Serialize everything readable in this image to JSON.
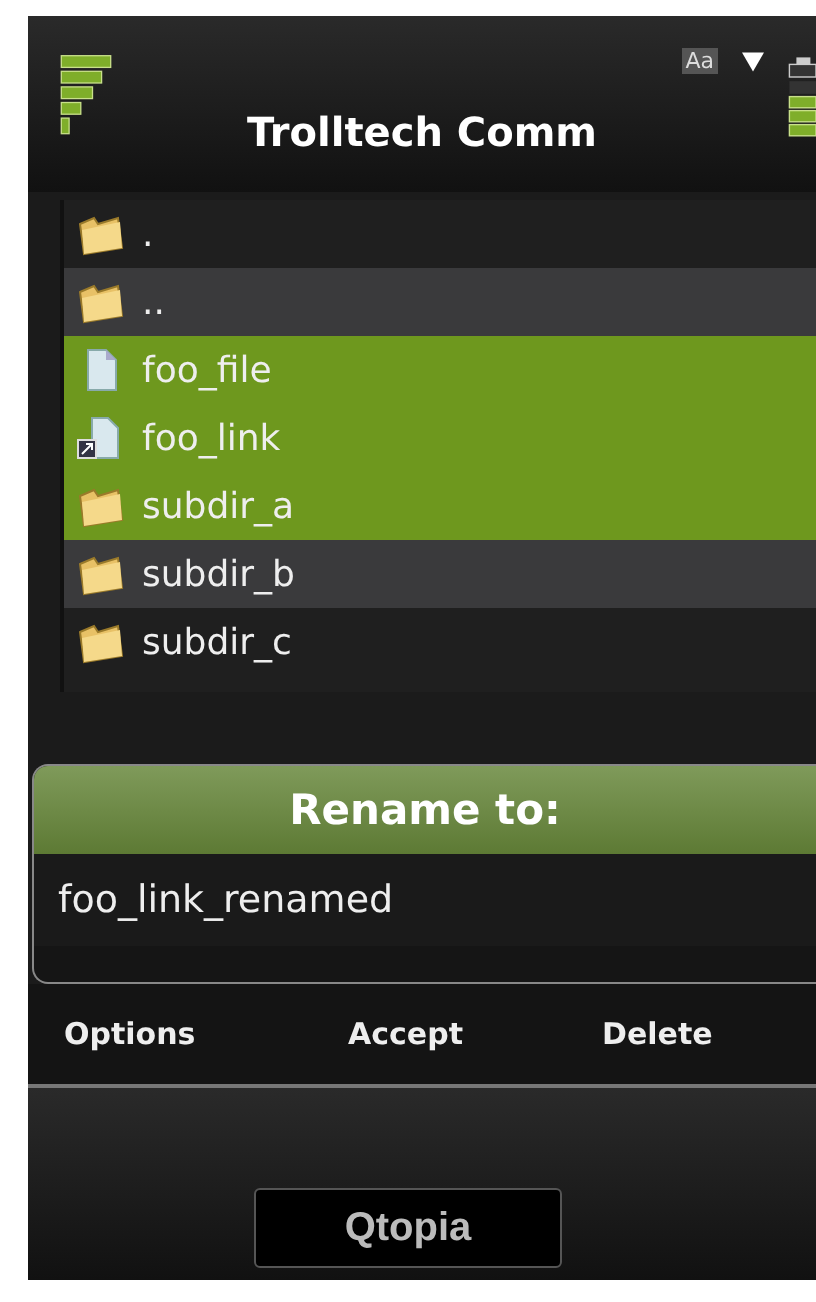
{
  "header": {
    "title": "Trolltech Comm",
    "input_mode": "Aa"
  },
  "files": [
    {
      "name": ".",
      "kind": "folder",
      "selected": false
    },
    {
      "name": "..",
      "kind": "folder",
      "selected": false
    },
    {
      "name": "foo_file",
      "kind": "file",
      "selected": true
    },
    {
      "name": "foo_link",
      "kind": "link",
      "selected": true
    },
    {
      "name": "subdir_a",
      "kind": "folder",
      "selected": true
    },
    {
      "name": "subdir_b",
      "kind": "folder",
      "selected": false
    },
    {
      "name": "subdir_c",
      "kind": "folder",
      "selected": false
    }
  ],
  "dialog": {
    "title": "Rename to:",
    "value": "foo_link_renamed"
  },
  "softkeys": [
    "Options",
    "Accept",
    "Delete"
  ],
  "brand": "Qtopia"
}
